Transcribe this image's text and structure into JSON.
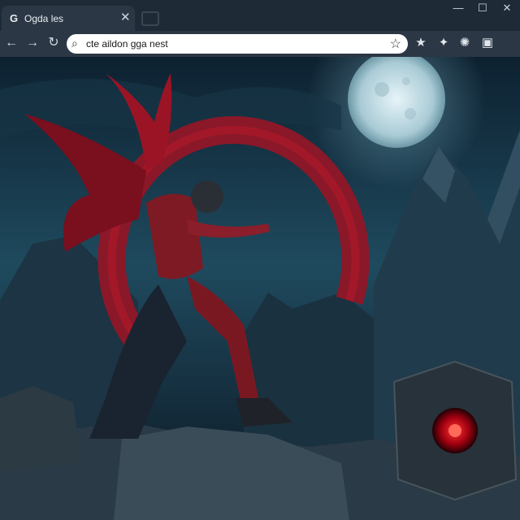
{
  "tab": {
    "favicon": "G",
    "title": "Ogda les",
    "close": "✕"
  },
  "window": {
    "minimize": "—",
    "maximize": "☐",
    "close": "✕"
  },
  "nav": {
    "back": "←",
    "forward": "→",
    "reload": "↻"
  },
  "address": {
    "icon": "search-icon",
    "url": "cte aildon gga nest"
  },
  "extensions": [
    "star-icon",
    "puzzle-icon",
    "settings-icon",
    "twitch-icon"
  ],
  "colors": {
    "tabbar": "#1e2a36",
    "toolbar": "#2b3744",
    "accent_red": "#c0182a",
    "moon": "#cfe6ee"
  }
}
